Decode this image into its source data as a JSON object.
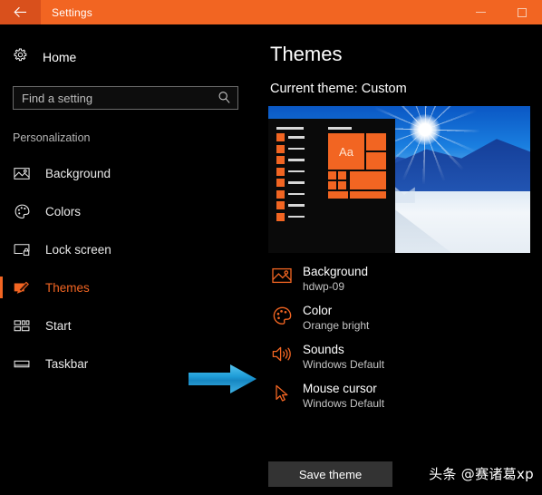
{
  "titlebar": {
    "title": "Settings",
    "back_icon": "back-arrow-icon",
    "minimize_icon": "minimize-icon",
    "maximize_icon": "maximize-icon",
    "accent_color": "#f26522",
    "back_hover_color": "#d9501c"
  },
  "sidebar": {
    "home": {
      "label": "Home",
      "icon": "gear-icon"
    },
    "search": {
      "placeholder": "Find a setting",
      "value": "",
      "icon": "search-icon"
    },
    "group_header": "Personalization",
    "items": [
      {
        "label": "Background",
        "icon": "picture-icon",
        "selected": false
      },
      {
        "label": "Colors",
        "icon": "palette-icon",
        "selected": false
      },
      {
        "label": "Lock screen",
        "icon": "lock-screen-icon",
        "selected": false
      },
      {
        "label": "Themes",
        "icon": "paintbrush-icon",
        "selected": true
      },
      {
        "label": "Start",
        "icon": "start-grid-icon",
        "selected": false
      },
      {
        "label": "Taskbar",
        "icon": "taskbar-icon",
        "selected": false
      }
    ]
  },
  "main": {
    "page_title": "Themes",
    "current_theme": "Current theme: Custom",
    "preview": {
      "tile_text": "Aa",
      "app_count": 8
    },
    "theme_items": [
      {
        "name": "Background",
        "value": "hdwp-09",
        "icon": "picture-icon"
      },
      {
        "name": "Color",
        "value": "Orange bright",
        "icon": "palette-icon"
      },
      {
        "name": "Sounds",
        "value": "Windows Default",
        "icon": "speaker-icon"
      },
      {
        "name": "Mouse cursor",
        "value": "Windows Default",
        "icon": "cursor-icon"
      }
    ],
    "save_button": "Save theme",
    "annotation_arrow": {
      "icon": "right-arrow-icon",
      "points_at": "Sounds",
      "color": "#1e9cd7"
    }
  },
  "watermark": "头条 @赛诸葛xp"
}
